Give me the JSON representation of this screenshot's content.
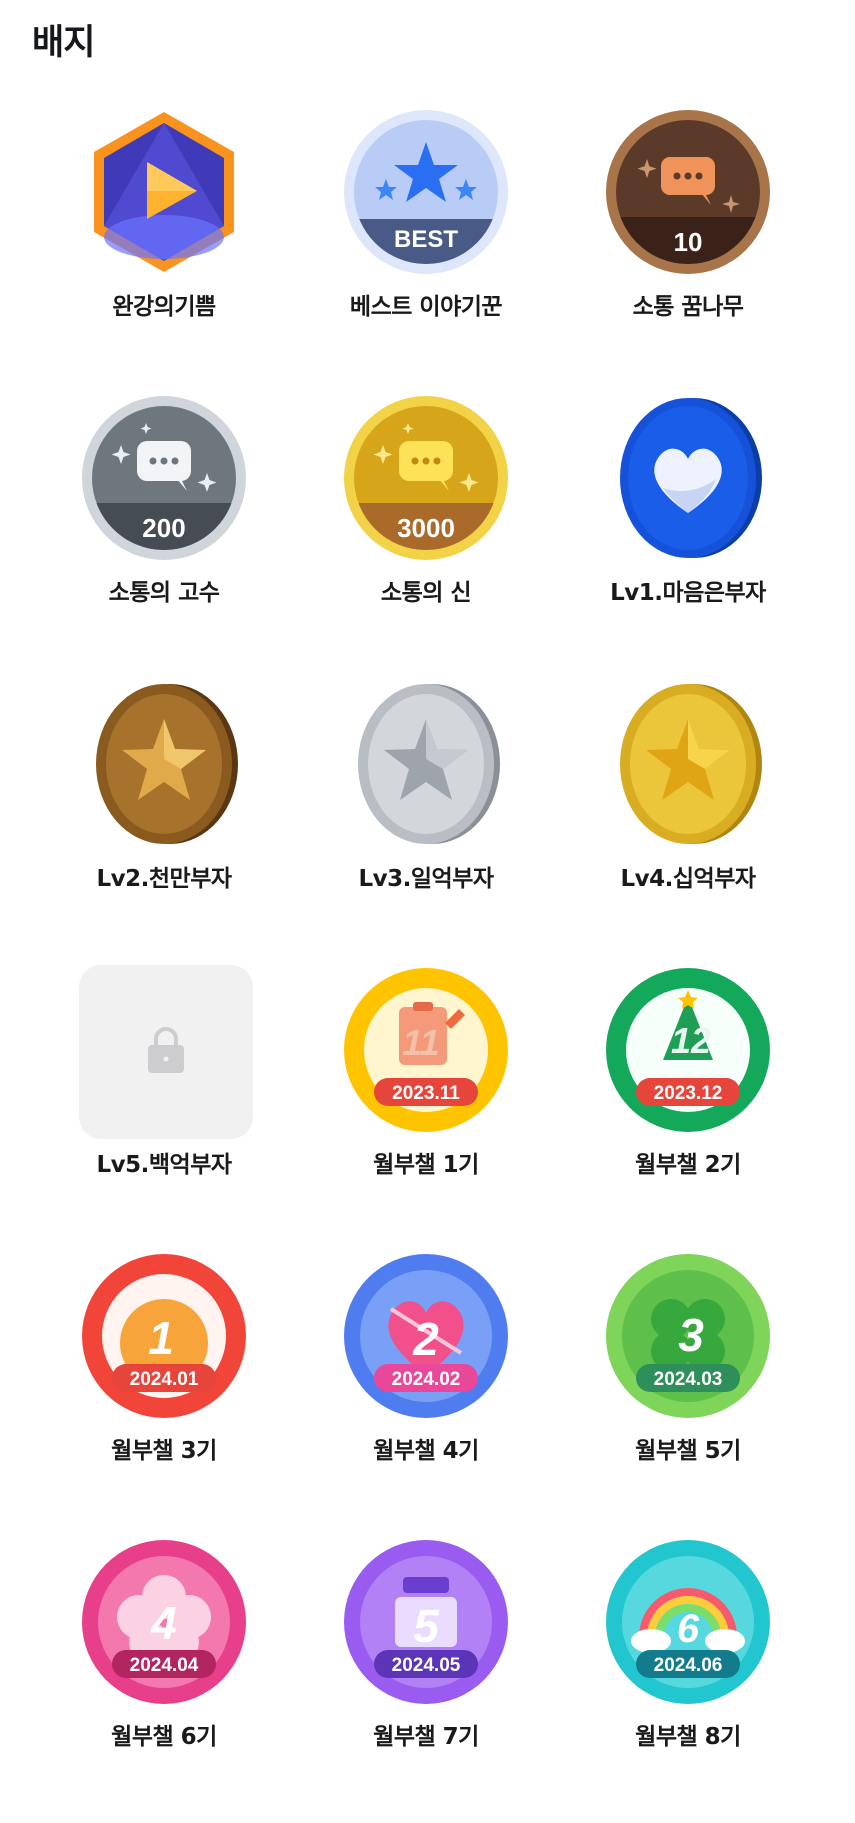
{
  "page": {
    "title": "배지"
  },
  "colors": {
    "bronze": "#a8744a",
    "silver": "#c9ced4",
    "gold": "#d9a81c",
    "blue": "#1652d9",
    "locked_bg": "#f1f1f2"
  },
  "badges": [
    {
      "label": "완강의기쁨",
      "icon": "hexagon-play-icon"
    },
    {
      "label": "베스트 이야기꾼",
      "icon": "best-star-icon",
      "text": "BEST"
    },
    {
      "label": "소통 꿈나무",
      "icon": "chat-10-icon",
      "text": "10"
    },
    {
      "label": "소통의 고수",
      "icon": "chat-200-icon",
      "text": "200"
    },
    {
      "label": "소통의 신",
      "icon": "chat-3000-icon",
      "text": "3000"
    },
    {
      "label": "Lv1.마음은부자",
      "icon": "heart-coin-icon"
    },
    {
      "label": "Lv2.천만부자",
      "icon": "bronze-star-coin-icon"
    },
    {
      "label": "Lv3.일억부자",
      "icon": "silver-star-coin-icon"
    },
    {
      "label": "Lv4.십억부자",
      "icon": "gold-star-coin-icon"
    },
    {
      "label": "Lv5.백억부자",
      "icon": "lock-icon",
      "locked": true
    },
    {
      "label": "월부챌 1기",
      "icon": "month-badge-icon",
      "number": "11",
      "date": "2023.11"
    },
    {
      "label": "월부챌 2기",
      "icon": "month-badge-icon",
      "number": "12",
      "date": "2023.12"
    },
    {
      "label": "월부챌 3기",
      "icon": "month-badge-icon",
      "number": "1",
      "date": "2024.01"
    },
    {
      "label": "월부챌 4기",
      "icon": "month-badge-icon",
      "number": "2",
      "date": "2024.02"
    },
    {
      "label": "월부챌 5기",
      "icon": "month-badge-icon",
      "number": "3",
      "date": "2024.03"
    },
    {
      "label": "월부챌 6기",
      "icon": "month-badge-icon",
      "number": "4",
      "date": "2024.04"
    },
    {
      "label": "월부챌 7기",
      "icon": "month-badge-icon",
      "number": "5",
      "date": "2024.05"
    },
    {
      "label": "월부챌 8기",
      "icon": "month-badge-icon",
      "number": "6",
      "date": "2024.06"
    }
  ]
}
